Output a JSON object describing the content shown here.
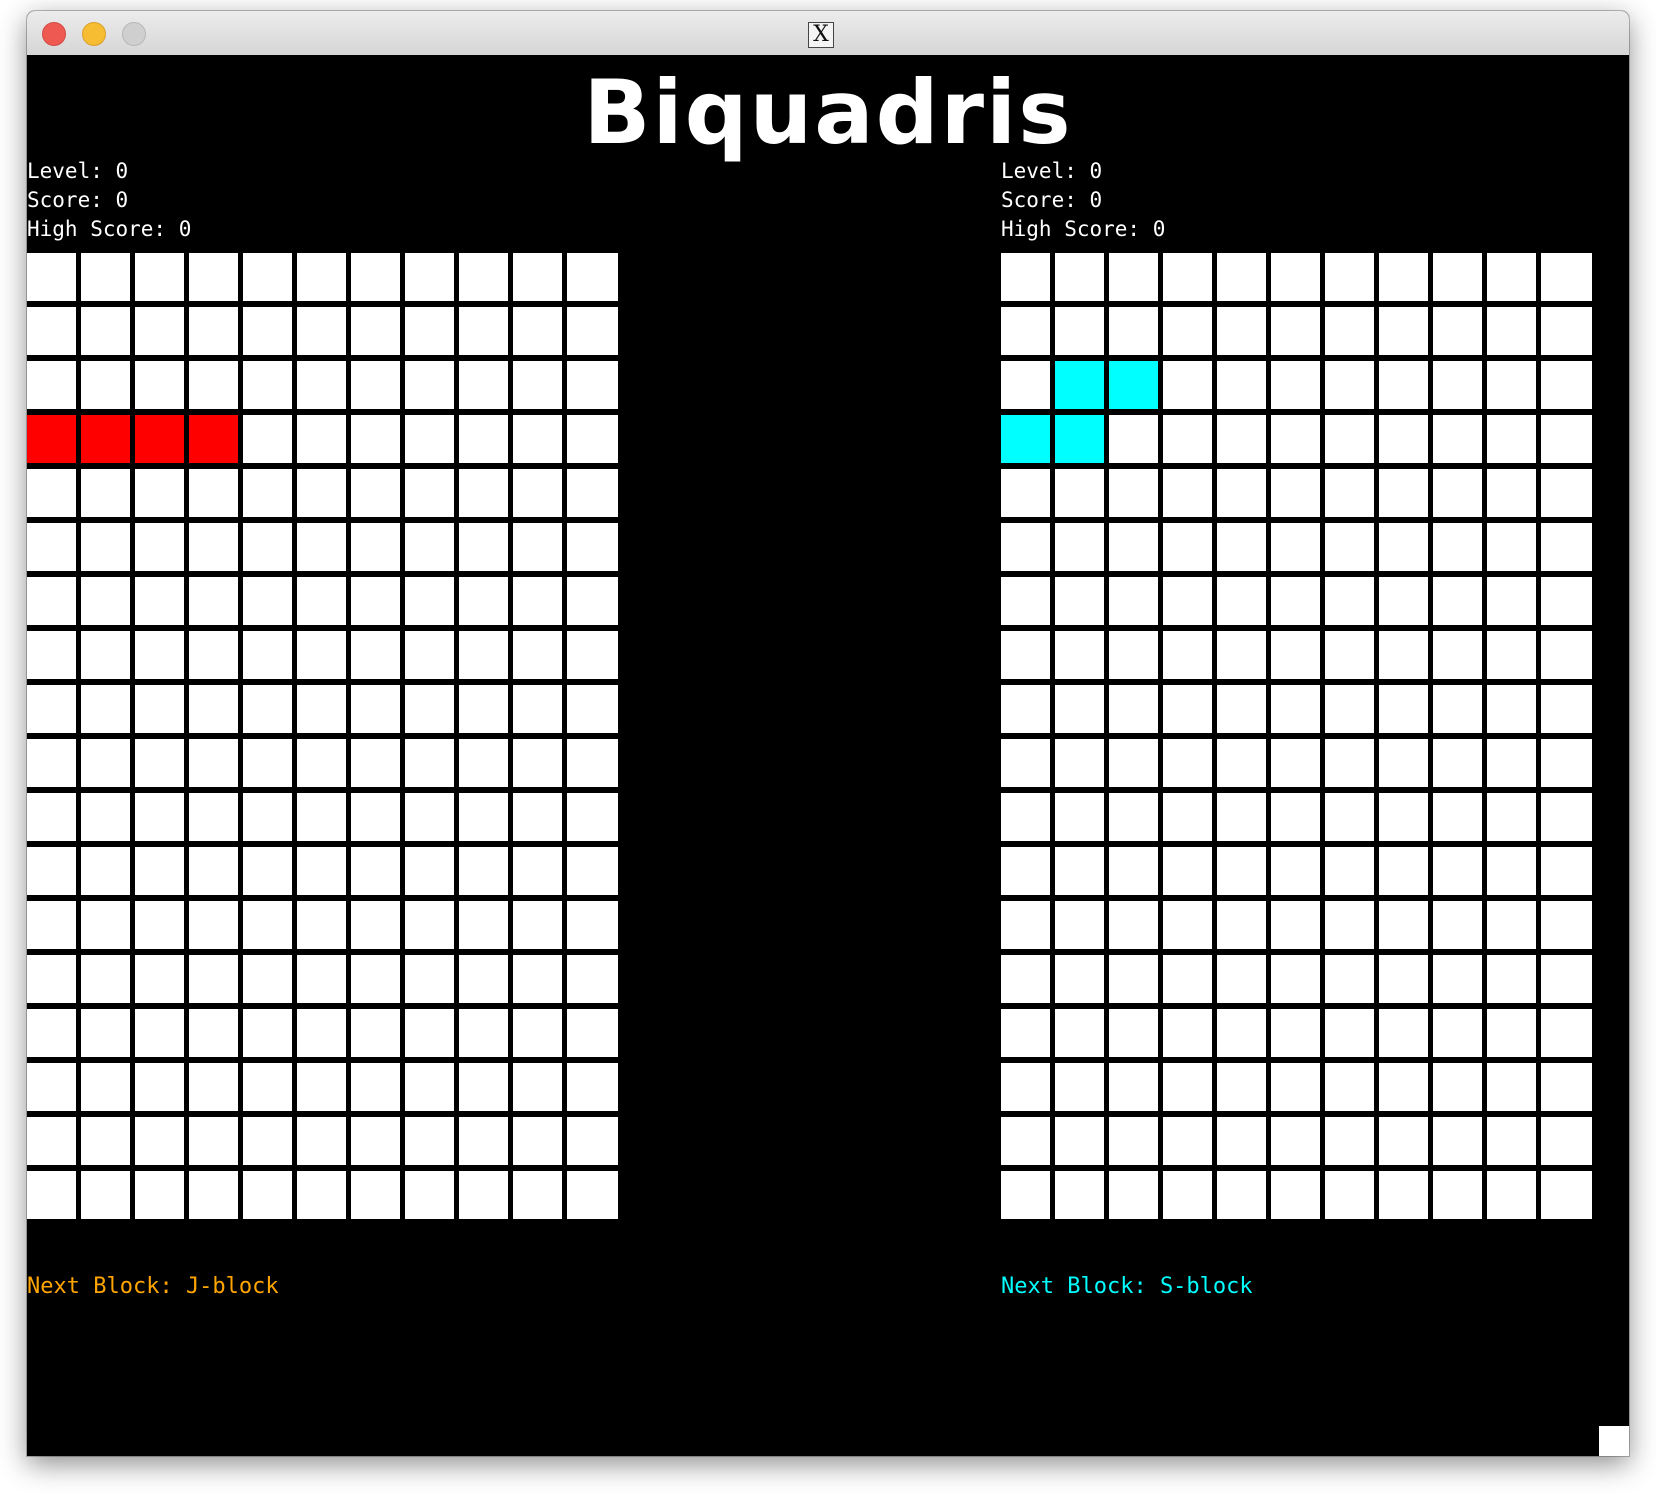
{
  "window": {
    "title_icon": "x11-icon",
    "buttons": [
      "close",
      "minimize",
      "zoom"
    ]
  },
  "game": {
    "title": "Biquadris",
    "players": [
      {
        "level_label": "Level: 0",
        "score_label": "Score: 0",
        "high_score_label": "High Score: 0",
        "next_block_label": "Next Block: J-block",
        "next_block_color": "#ffa500",
        "board": {
          "columns": 11,
          "rows": 18,
          "empty_color": "#ffffff",
          "filled_cells": [
            {
              "row": 3,
              "col": 0,
              "color": "#ff0000"
            },
            {
              "row": 3,
              "col": 1,
              "color": "#ff0000"
            },
            {
              "row": 3,
              "col": 2,
              "color": "#ff0000"
            },
            {
              "row": 3,
              "col": 3,
              "color": "#ff0000"
            }
          ]
        }
      },
      {
        "level_label": "Level: 0",
        "score_label": "Score: 0",
        "high_score_label": "High Score: 0",
        "next_block_label": "Next Block: S-block",
        "next_block_color": "#00ffff",
        "board": {
          "columns": 11,
          "rows": 18,
          "empty_color": "#ffffff",
          "filled_cells": [
            {
              "row": 2,
              "col": 1,
              "color": "#00ffff"
            },
            {
              "row": 2,
              "col": 2,
              "color": "#00ffff"
            },
            {
              "row": 3,
              "col": 0,
              "color": "#00ffff"
            },
            {
              "row": 3,
              "col": 1,
              "color": "#00ffff"
            }
          ]
        }
      }
    ]
  }
}
